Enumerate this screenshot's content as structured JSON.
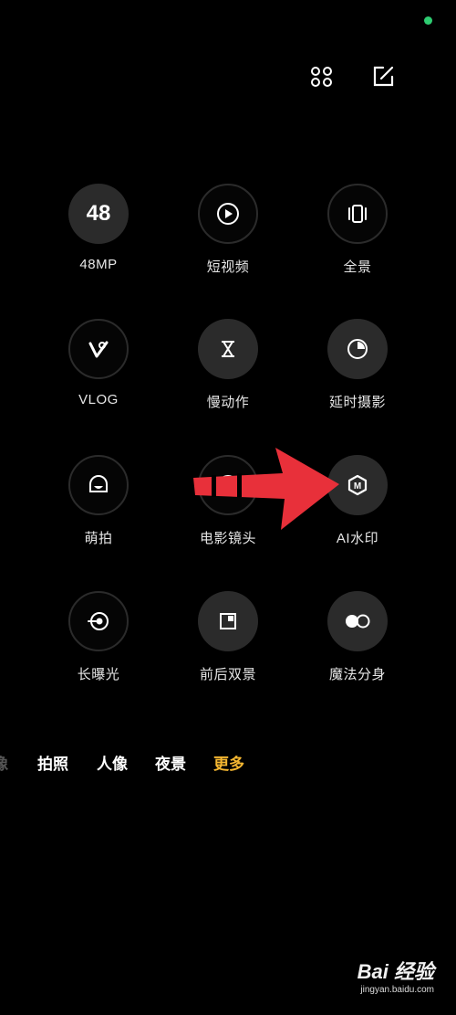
{
  "status": {
    "indicator_color": "#2ecc71"
  },
  "top_bar": {
    "grid_icon": "grid-2x3-icon",
    "edit_icon": "edit-icon"
  },
  "modes": [
    {
      "label": "48MP",
      "icon": "48",
      "style": "filled"
    },
    {
      "label": "短视频",
      "icon": "play-icon",
      "style": "outline"
    },
    {
      "label": "全景",
      "icon": "panorama-icon",
      "style": "outline"
    },
    {
      "label": "VLOG",
      "icon": "vlog-icon",
      "style": "outline"
    },
    {
      "label": "慢动作",
      "icon": "hourglass-icon",
      "style": "filled"
    },
    {
      "label": "延时摄影",
      "icon": "timelapse-icon",
      "style": "filled"
    },
    {
      "label": "萌拍",
      "icon": "cute-face-icon",
      "style": "outline"
    },
    {
      "label": "电影镜头",
      "icon": "movie-icon",
      "style": "outline"
    },
    {
      "label": "AI水印",
      "icon": "hexagon-m-icon",
      "style": "filled"
    },
    {
      "label": "长曝光",
      "icon": "long-exposure-icon",
      "style": "outline"
    },
    {
      "label": "前后双景",
      "icon": "dual-view-icon",
      "style": "filled"
    },
    {
      "label": "魔法分身",
      "icon": "clone-icon",
      "style": "filled"
    }
  ],
  "tabs": [
    {
      "label": "像",
      "state": "faded"
    },
    {
      "label": "拍照",
      "state": "normal"
    },
    {
      "label": "人像",
      "state": "normal"
    },
    {
      "label": "夜景",
      "state": "normal"
    },
    {
      "label": "更多",
      "state": "active"
    }
  ],
  "colors": {
    "accent": "#f5b731",
    "arrow": "#e8303a"
  },
  "watermark": {
    "logo": "Bai 经验",
    "url": "jingyan.baidu.com"
  }
}
